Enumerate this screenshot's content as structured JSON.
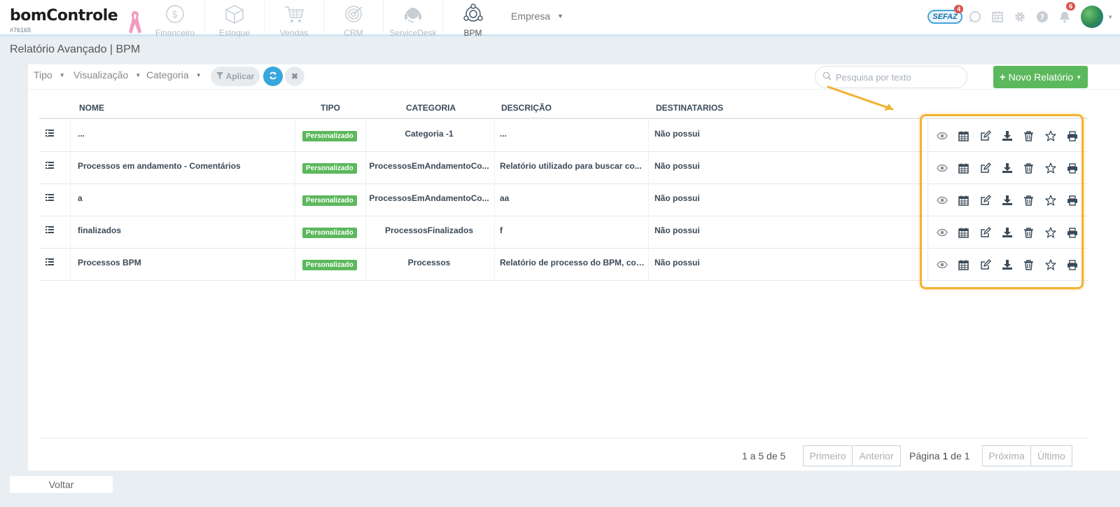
{
  "brand": {
    "logo_text": "bomControle",
    "account_id": "#76165"
  },
  "nav": {
    "modules": [
      {
        "label": "Financeiro",
        "icon": "dollar-coin-icon",
        "active": false
      },
      {
        "label": "Estoque",
        "icon": "box-icon",
        "active": false
      },
      {
        "label": "Vendas",
        "icon": "cart-icon",
        "active": false
      },
      {
        "label": "CRM",
        "icon": "target-icon",
        "active": false
      },
      {
        "label": "ServiceDesk",
        "icon": "headset-icon",
        "active": false
      },
      {
        "label": "BPM",
        "icon": "process-cycle-icon",
        "active": true
      }
    ],
    "empresa_label": "Empresa",
    "sefaz_label": "SEFAZ",
    "sefaz_badge": "4",
    "notifications_badge": "6"
  },
  "page": {
    "title": "Relatório Avançado | BPM"
  },
  "filters": {
    "tipo": "Tipo",
    "visualizacao": "Visualização",
    "categoria": "Categoria",
    "apply_label": "Aplicar",
    "search_placeholder": "Pesquisa por texto",
    "new_report_label": "Novo Relatório"
  },
  "table": {
    "headers": {
      "nome": "NOME",
      "tipo": "TIPO",
      "categoria": "CATEGORIA",
      "descricao": "DESCRIÇÃO",
      "destinatarios": "DESTINATARIOS"
    },
    "rows": [
      {
        "nome": "...",
        "tipo": "Personalizado",
        "categoria": "Categoria -1",
        "descricao": "...",
        "destinatarios": "Não possui"
      },
      {
        "nome": "Processos em andamento - Comentários",
        "tipo": "Personalizado",
        "categoria": "ProcessosEmAndamentoCo...",
        "descricao": "Relatório utilizado para buscar co...",
        "destinatarios": "Não possui"
      },
      {
        "nome": "a",
        "tipo": "Personalizado",
        "categoria": "ProcessosEmAndamentoCo...",
        "descricao": "aa",
        "destinatarios": "Não possui"
      },
      {
        "nome": "finalizados",
        "tipo": "Personalizado",
        "categoria": "ProcessosFinalizados",
        "descricao": "f",
        "destinatarios": "Não possui"
      },
      {
        "nome": "Processos BPM",
        "tipo": "Personalizado",
        "categoria": "Processos",
        "descricao": "Relatório de processo do BPM, cont...",
        "destinatarios": "Não possui"
      }
    ],
    "row_actions": [
      "eye-icon",
      "calendar-icon",
      "edit-icon",
      "download-icon",
      "trash-icon",
      "star-icon",
      "print-icon"
    ]
  },
  "pagination": {
    "count": "1 a 5 de 5",
    "first": "Primeiro",
    "previous": "Anterior",
    "page_prefix": "Página",
    "page_current": "1",
    "page_of": "de 1",
    "next": "Próxima",
    "last": "Último"
  },
  "footer": {
    "back_label": "Voltar"
  },
  "colors": {
    "accent_green": "#5cb85c",
    "accent_blue": "#37a7dc",
    "highlight": "#f2b233",
    "text_dark": "#3a4a59"
  }
}
